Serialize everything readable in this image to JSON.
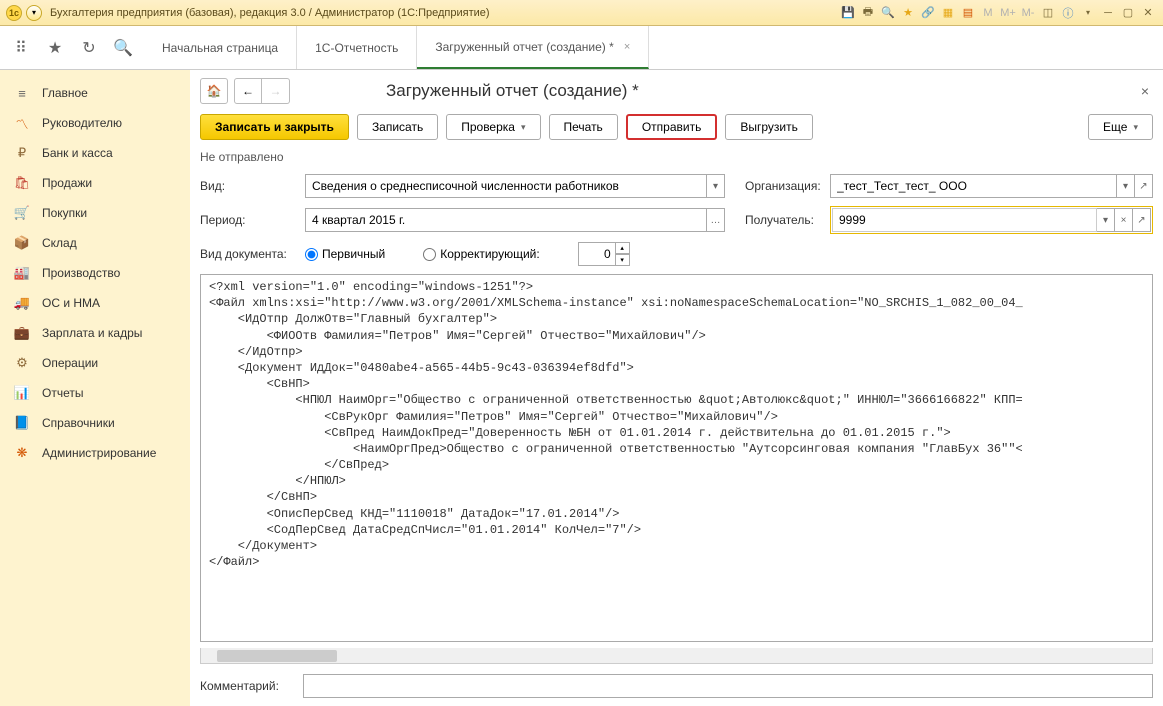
{
  "titlebar": {
    "title": "Бухгалтерия предприятия (базовая), редакция 3.0 / Администратор  (1С:Предприятие)",
    "m_labels": [
      "M",
      "M+",
      "M-"
    ]
  },
  "topnav": {
    "tabs": [
      {
        "label": "Начальная страница",
        "closable": false
      },
      {
        "label": "1С-Отчетность",
        "closable": false
      },
      {
        "label": "Загруженный отчет (создание) *",
        "closable": true,
        "active": true
      }
    ]
  },
  "sidebar": {
    "items": [
      {
        "icon": "≡",
        "label": "Главное",
        "color": "#666"
      },
      {
        "icon": "〽",
        "label": "Руководителю",
        "color": "#d35400"
      },
      {
        "icon": "₽",
        "label": "Банк и касса",
        "color": "#8e6a3a"
      },
      {
        "icon": "🛍",
        "label": "Продажи",
        "color": "#c0392b"
      },
      {
        "icon": "🛒",
        "label": "Покупки",
        "color": "#8e6a3a"
      },
      {
        "icon": "📦",
        "label": "Склад",
        "color": "#a67c3d"
      },
      {
        "icon": "🏭",
        "label": "Производство",
        "color": "#666"
      },
      {
        "icon": "🚚",
        "label": "ОС и НМА",
        "color": "#555"
      },
      {
        "icon": "💼",
        "label": "Зарплата и кадры",
        "color": "#8e6a3a"
      },
      {
        "icon": "⚙",
        "label": "Операции",
        "color": "#8e6a3a"
      },
      {
        "icon": "📊",
        "label": "Отчеты",
        "color": "#8e6a3a"
      },
      {
        "icon": "📘",
        "label": "Справочники",
        "color": "#8e6a3a"
      },
      {
        "icon": "❋",
        "label": "Администрирование",
        "color": "#d35400"
      }
    ]
  },
  "content": {
    "page_title": "Загруженный отчет (создание) *",
    "toolbar": {
      "save_close": "Записать и закрыть",
      "save": "Записать",
      "check": "Проверка",
      "print": "Печать",
      "send": "Отправить",
      "export": "Выгрузить",
      "more": "Еще"
    },
    "status": "Не отправлено",
    "form": {
      "kind_label": "Вид:",
      "kind_value": "Сведения о среднесписочной численности работников",
      "org_label": "Организация:",
      "org_value": "_тест_Тест_тест_ ООО",
      "period_label": "Период:",
      "period_value": "4 квартал 2015 г.",
      "recipient_label": "Получатель:",
      "recipient_value": "9999",
      "doctype_label": "Вид документа:",
      "radio_primary": "Первичный",
      "radio_corrective": "Корректирующий:",
      "corrective_value": "0"
    },
    "xml": "<?xml version=\"1.0\" encoding=\"windows-1251\"?>\n<Файл xmlns:xsi=\"http://www.w3.org/2001/XMLSchema-instance\" xsi:noNamespaceSchemaLocation=\"NO_SRCHIS_1_082_00_04_\n    <ИдОтпр ДолжОтв=\"Главный бухгалтер\">\n        <ФИООтв Фамилия=\"Петров\" Имя=\"Сергей\" Отчество=\"Михайлович\"/>\n    </ИдОтпр>\n    <Документ ИдДок=\"0480abe4-a565-44b5-9c43-036394ef8dfd\">\n        <СвНП>\n            <НПЮЛ НаимОрг=\"Общество с ограниченной ответственностью &quot;Автолюкс&quot;\" ИННЮЛ=\"3666166822\" КПП=\n                <СвРукОрг Фамилия=\"Петров\" Имя=\"Сергей\" Отчество=\"Михайлович\"/>\n                <СвПред НаимДокПред=\"Доверенность №БН от 01.01.2014 г. действительна до 01.01.2015 г.\">\n                    <НаимОргПред>Общество с ограниченной ответственностью \"Аутсорсинговая компания \"ГлавБух 36\"\"<\n                </СвПред>\n            </НПЮЛ>\n        </СвНП>\n        <ОписПерСвед КНД=\"1110018\" ДатаДок=\"17.01.2014\"/>\n        <СодПерСвед ДатаСредСпЧисл=\"01.01.2014\" КолЧел=\"7\"/>\n    </Документ>\n</Файл>",
    "comment_label": "Комментарий:",
    "comment_value": ""
  }
}
